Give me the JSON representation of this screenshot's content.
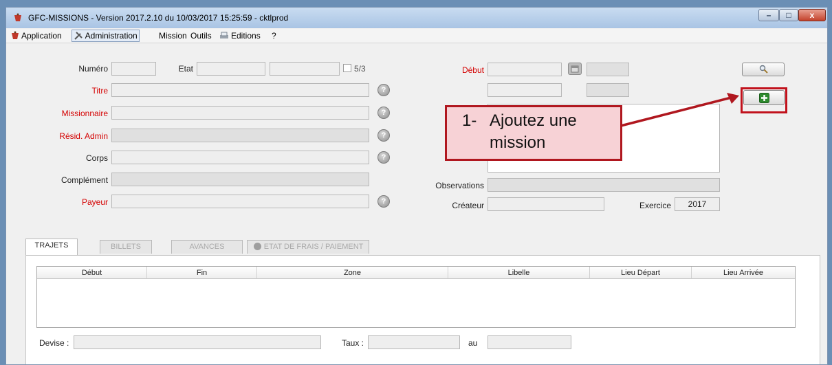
{
  "window": {
    "title": "GFC-MISSIONS - Version 2017.2.10 du 10/03/2017 15:25:59 - cktlprod",
    "controls": {
      "minimize": "–",
      "maximize": "□",
      "close": "x"
    }
  },
  "menu": {
    "items": [
      {
        "label": "Application",
        "icon": "app-icon"
      },
      {
        "label": "Administration",
        "icon": "tools-icon"
      },
      {
        "label": "Mission"
      },
      {
        "label": "Outils"
      },
      {
        "label": "Editions",
        "icon": "printer-icon"
      },
      {
        "label": "?"
      }
    ]
  },
  "form": {
    "numero_label": "Numéro",
    "etat_label": "Etat",
    "checkbox_label": "5/3",
    "titre_label": "Titre",
    "missionnaire_label": "Missionnaire",
    "resid_label": "Résid. Admin",
    "corps_label": "Corps",
    "complement_label": "Complément",
    "payeur_label": "Payeur",
    "debut_label": "Début",
    "observations_label": "Observations",
    "createur_label": "Créateur",
    "exercice_label": "Exercice",
    "exercice_value": "2017"
  },
  "tabs": [
    {
      "label": "TRAJETS",
      "active": true
    },
    {
      "label": "BILLETS",
      "active": false
    },
    {
      "label": "AVANCES",
      "active": false
    },
    {
      "label": "ETAT DE FRAIS / PAIEMENT",
      "active": false
    }
  ],
  "table": {
    "columns": [
      "Début",
      "Fin",
      "Zone",
      "Libelle",
      "Lieu Départ",
      "Lieu Arrivée"
    ]
  },
  "footer": {
    "devise_label": "Devise :",
    "taux_label": "Taux :",
    "au_label": "au"
  },
  "callout": {
    "text": "1-   Ajoutez une\n      mission"
  },
  "colors": {
    "required_label": "#d40000",
    "callout_border": "#b0171f",
    "callout_fill": "#f7d2d6",
    "add_button": "#2e8b2e"
  }
}
